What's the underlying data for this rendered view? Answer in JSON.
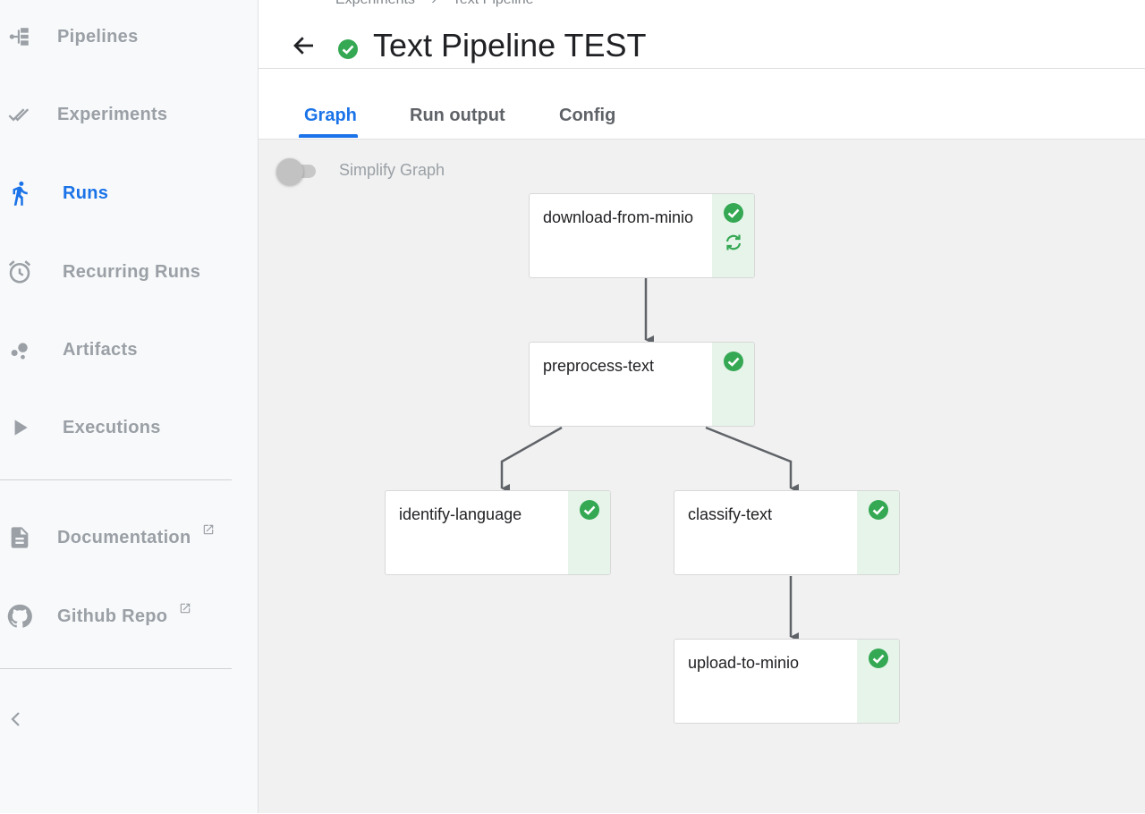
{
  "sidebar": {
    "items": [
      {
        "label": "Pipelines",
        "icon": "pipelines-icon"
      },
      {
        "label": "Experiments",
        "icon": "experiments-icon"
      },
      {
        "label": "Runs",
        "icon": "runs-icon",
        "active": true
      },
      {
        "label": "Recurring Runs",
        "icon": "alarm-icon"
      },
      {
        "label": "Artifacts",
        "icon": "artifacts-icon"
      },
      {
        "label": "Executions",
        "icon": "play-icon"
      }
    ],
    "external": [
      {
        "label": "Documentation",
        "icon": "document-icon"
      },
      {
        "label": "Github Repo",
        "icon": "github-icon"
      }
    ]
  },
  "header": {
    "breadcrumb": [
      "Experiments",
      "›",
      "Text Pipeline"
    ],
    "title": "Text Pipeline TEST"
  },
  "tabs": [
    {
      "label": "Graph",
      "active": true
    },
    {
      "label": "Run output"
    },
    {
      "label": "Config"
    }
  ],
  "graph": {
    "simplify_label": "Simplify Graph",
    "simplify_on": false,
    "nodes": [
      {
        "id": "download",
        "label": "download-from-minio",
        "status": "succeeded",
        "cached": true
      },
      {
        "id": "preprocess",
        "label": "preprocess-text",
        "status": "succeeded"
      },
      {
        "id": "identify",
        "label": "identify-language",
        "status": "succeeded"
      },
      {
        "id": "classify",
        "label": "classify-text",
        "status": "succeeded"
      },
      {
        "id": "upload",
        "label": "upload-to-minio",
        "status": "succeeded"
      }
    ],
    "edges": [
      [
        "download",
        "preprocess"
      ],
      [
        "preprocess",
        "identify"
      ],
      [
        "preprocess",
        "classify"
      ],
      [
        "classify",
        "upload"
      ]
    ]
  },
  "colors": {
    "accent": "#1a73e8",
    "success": "#34a853",
    "status_bg": "#e6f4ea",
    "muted": "#9aa0a6",
    "edge": "#5f6368"
  }
}
